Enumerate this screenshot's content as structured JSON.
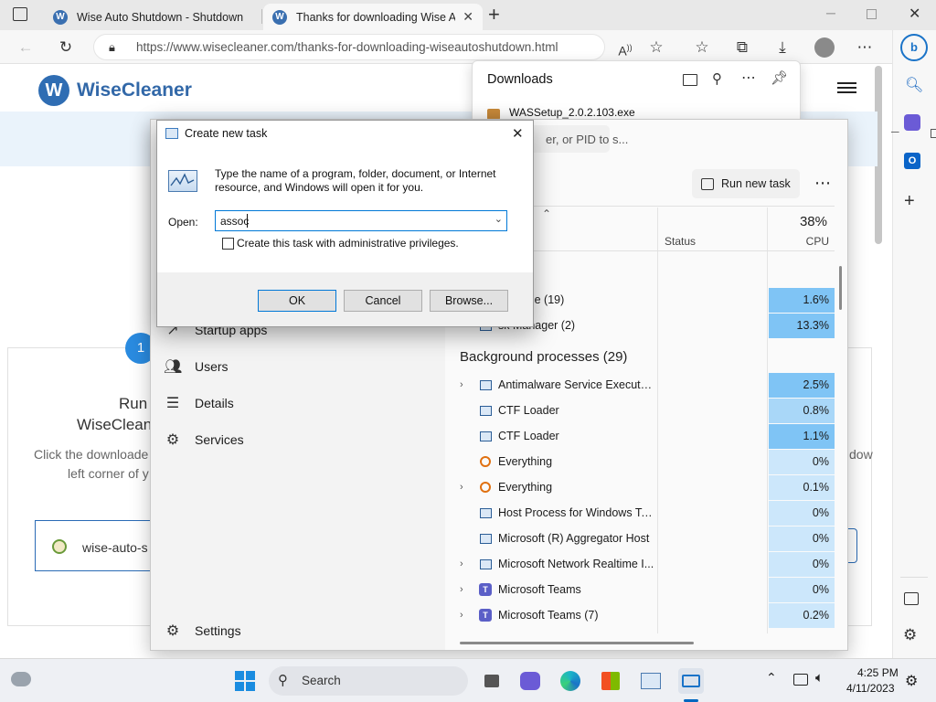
{
  "browser": {
    "tabs": [
      {
        "title": "Wise Auto Shutdown - Shutdown",
        "active": false
      },
      {
        "title": "Thanks for downloading Wise Au",
        "active": true
      }
    ],
    "url_host": "https://www.wisecleaner.com",
    "url_path": "/thanks-for-downloading-wiseautoshutdown.html"
  },
  "page": {
    "logo_text": "WiseCleaner",
    "step_number": "1",
    "run_heading_line1": "Run t",
    "run_heading_line2": "WiseCleane",
    "instructions_line1": "Click the downloade",
    "instructions_line2": "left corner of y",
    "instructions_right": "dow",
    "file_label": "wise-auto-s"
  },
  "downloads": {
    "title": "Downloads",
    "item": "WASSetup_2.0.2.103.exe"
  },
  "task_manager": {
    "search_placeholder": "er, or PID to s...",
    "run_new_task": "Run new task",
    "status_header": "Status",
    "cpu_percent": "38%",
    "cpu_label": "CPU",
    "nav": [
      {
        "label": "Startup apps",
        "icon": "startup-icon"
      },
      {
        "label": "Users",
        "icon": "users-icon"
      },
      {
        "label": "Details",
        "icon": "details-icon"
      },
      {
        "label": "Services",
        "icon": "services-icon"
      }
    ],
    "settings": "Settings",
    "apps": [
      {
        "name": "oft Edge (19)",
        "cpu": "1.6%"
      },
      {
        "name": "sk Manager (2)",
        "cpu": "13.3%"
      }
    ],
    "bg_header": "Background processes (29)",
    "processes": [
      {
        "name": "Antimalware Service Executable",
        "cpu": "2.5%",
        "expand": true,
        "icon": "window"
      },
      {
        "name": "CTF Loader",
        "cpu": "0.8%",
        "expand": false,
        "icon": "window"
      },
      {
        "name": "CTF Loader",
        "cpu": "1.1%",
        "expand": false,
        "icon": "window"
      },
      {
        "name": "Everything",
        "cpu": "0%",
        "expand": false,
        "icon": "search"
      },
      {
        "name": "Everything",
        "cpu": "0.1%",
        "expand": true,
        "icon": "search"
      },
      {
        "name": "Host Process for Windows Tasks",
        "cpu": "0%",
        "expand": false,
        "icon": "window"
      },
      {
        "name": "Microsoft (R) Aggregator Host",
        "cpu": "0%",
        "expand": false,
        "icon": "window"
      },
      {
        "name": "Microsoft Network Realtime I...",
        "cpu": "0%",
        "expand": true,
        "icon": "window"
      },
      {
        "name": "Microsoft Teams",
        "cpu": "0%",
        "expand": true,
        "icon": "teams"
      },
      {
        "name": "Microsoft Teams (7)",
        "cpu": "0.2%",
        "expand": true,
        "icon": "teams"
      }
    ]
  },
  "dialog": {
    "title": "Create new task",
    "description": "Type the name of a program, folder, document, or Internet resource, and Windows will open it for you.",
    "open_label": "Open:",
    "open_value": "assoc",
    "admin_checkbox": "Create this task with administrative privileges.",
    "ok": "OK",
    "cancel": "Cancel",
    "browse": "Browse..."
  },
  "taskbar": {
    "search": "Search",
    "time": "4:25 PM",
    "date": "4/11/2023"
  },
  "colors": {
    "cpu_high": "#7fc4f5",
    "cpu_mid": "#a9d7f8",
    "cpu_low": "#cce7fb",
    "accent": "#0067c0"
  }
}
